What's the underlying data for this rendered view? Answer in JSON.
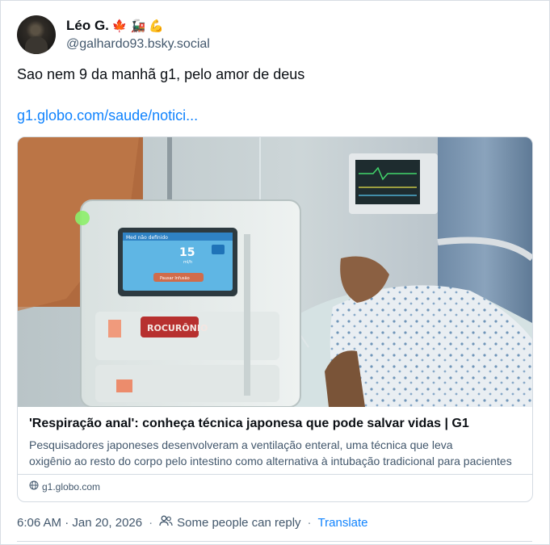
{
  "author": {
    "display_name": "Léo G.",
    "emojis": [
      "🍁",
      "🚂",
      "💪"
    ],
    "handle": "@galhardo93.bsky.social"
  },
  "post": {
    "text": "Sao nem 9 da manhã g1, pelo amor de deus",
    "link_text": "g1.globo.com/saude/notici..."
  },
  "card": {
    "image_labels": {
      "monitor_header": "Med não definido",
      "monitor_value": "15",
      "monitor_unit": "ml/h",
      "monitor_button": "Pausar Infusão",
      "drug_label": "ROCURÔNIO"
    },
    "title": "'Respiração anal': conheça técnica japonesa que pode salvar vidas | G1",
    "description_line1": "Pesquisadores japoneses desenvolveram a ventilação enteral, uma técnica que leva",
    "description_line2": "oxigênio ao resto do corpo pelo intestino como alternativa à intubação tradicional para pacientes",
    "domain": "g1.globo.com"
  },
  "meta": {
    "timestamp": "6:06 AM · Jan 20, 2026",
    "separator": "·",
    "reply_setting": "Some people can reply",
    "translate_label": "Translate"
  },
  "colors": {
    "link": "#1083fe",
    "muted_text": "#42576c",
    "border": "#d4dbe2"
  },
  "icons": [
    "avatar-photo",
    "people-icon",
    "globe-icon"
  ]
}
